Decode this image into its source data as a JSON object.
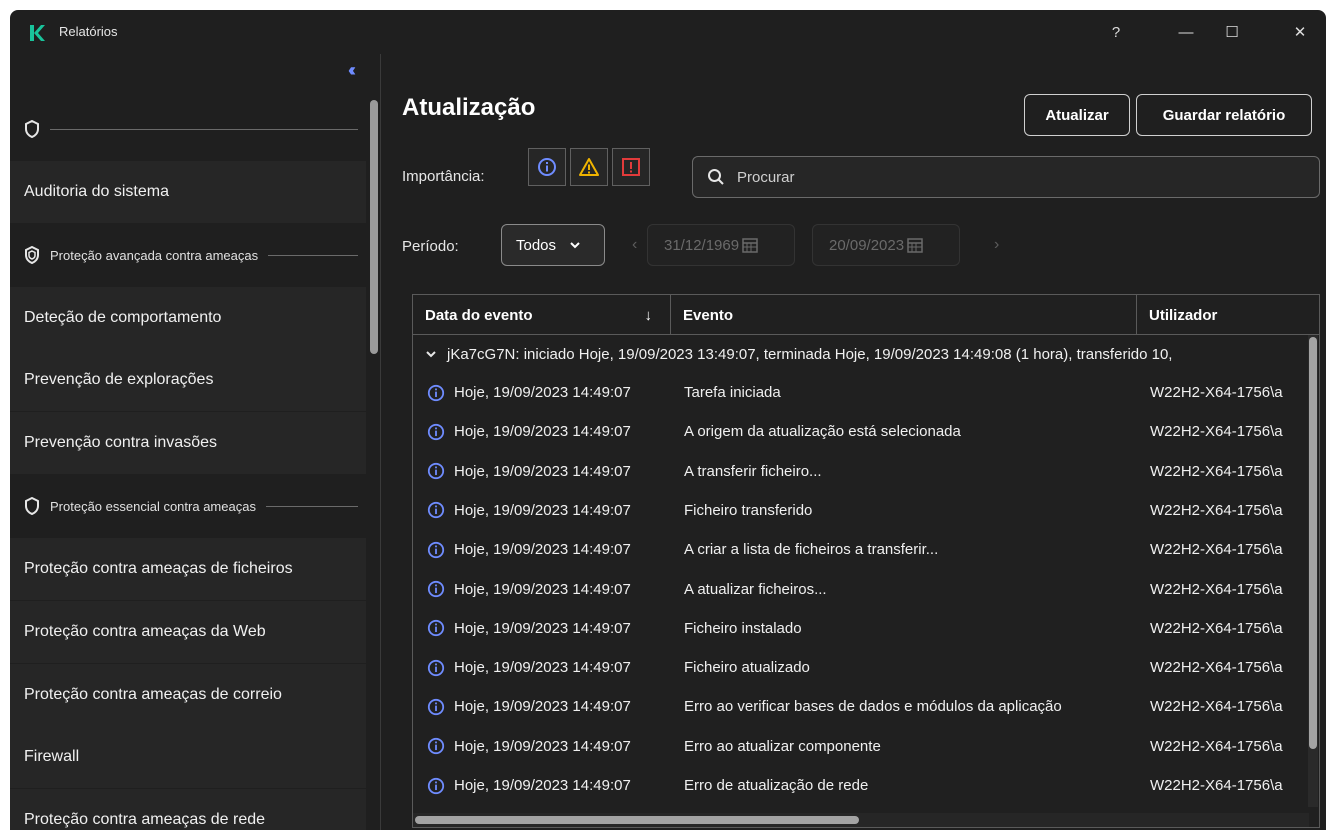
{
  "window": {
    "title": "Relatórios",
    "help_label": "?",
    "minimize_label": "—",
    "maximize_label": "☐",
    "close_label": "✕"
  },
  "colors": {
    "accent": "#19c39b",
    "info": "#6f8cff",
    "warning": "#f0b400",
    "error": "#e23b3b"
  },
  "sidebar": {
    "collapse_label": "‹‹",
    "group_top_label": "",
    "items": [
      {
        "label": "Auditoria do sistema"
      },
      {
        "label": "Deteção de comportamento"
      },
      {
        "label": "Prevenção de explorações"
      },
      {
        "label": "Prevenção contra invasões"
      },
      {
        "label": "Proteção contra ameaças de ficheiros"
      },
      {
        "label": "Proteção contra ameaças da Web"
      },
      {
        "label": "Proteção contra ameaças de correio"
      },
      {
        "label": "Firewall"
      },
      {
        "label": "Proteção contra ameaças de rede"
      }
    ],
    "groups": [
      {
        "label": "Proteção avançada contra ameaças",
        "icon": "shield-advanced-icon"
      },
      {
        "label": "Proteção essencial contra ameaças",
        "icon": "shield-icon"
      }
    ]
  },
  "main": {
    "title": "Atualização",
    "refresh_label": "Atualizar",
    "save_label": "Guardar relatório",
    "importance_label": "Importância:",
    "search_placeholder": "Procurar",
    "period_label": "Período:",
    "period_value": "Todos",
    "date_from": "31/12/1969",
    "date_to": "20/09/2023",
    "table": {
      "columns": [
        "Data do evento",
        "Evento",
        "Utilizador"
      ],
      "sort_indicator": "↓",
      "group_row": "jKa7cG7N: iniciado Hoje, 19/09/2023 13:49:07, terminada Hoje, 19/09/2023 14:49:08 (1 hora), transferido 10,",
      "rows": [
        {
          "date": "Hoje, 19/09/2023 14:49:07",
          "event": "Tarefa iniciada",
          "user": "W22H2-X64-1756\\a"
        },
        {
          "date": "Hoje, 19/09/2023 14:49:07",
          "event": "A origem da atualização está selecionada",
          "user": "W22H2-X64-1756\\a"
        },
        {
          "date": "Hoje, 19/09/2023 14:49:07",
          "event": "A transferir ficheiro...",
          "user": "W22H2-X64-1756\\a"
        },
        {
          "date": "Hoje, 19/09/2023 14:49:07",
          "event": "Ficheiro transferido",
          "user": "W22H2-X64-1756\\a"
        },
        {
          "date": "Hoje, 19/09/2023 14:49:07",
          "event": "A criar a lista de ficheiros a transferir...",
          "user": "W22H2-X64-1756\\a"
        },
        {
          "date": "Hoje, 19/09/2023 14:49:07",
          "event": "A atualizar ficheiros...",
          "user": "W22H2-X64-1756\\a"
        },
        {
          "date": "Hoje, 19/09/2023 14:49:07",
          "event": "Ficheiro instalado",
          "user": "W22H2-X64-1756\\a"
        },
        {
          "date": "Hoje, 19/09/2023 14:49:07",
          "event": "Ficheiro atualizado",
          "user": "W22H2-X64-1756\\a"
        },
        {
          "date": "Hoje, 19/09/2023 14:49:07",
          "event": "Erro ao verificar bases de dados e módulos da aplicação",
          "user": "W22H2-X64-1756\\a"
        },
        {
          "date": "Hoje, 19/09/2023 14:49:07",
          "event": "Erro ao atualizar componente",
          "user": "W22H2-X64-1756\\a"
        },
        {
          "date": "Hoje, 19/09/2023 14:49:07",
          "event": "Erro de atualização de rede",
          "user": "W22H2-X64-1756\\a"
        }
      ]
    }
  }
}
